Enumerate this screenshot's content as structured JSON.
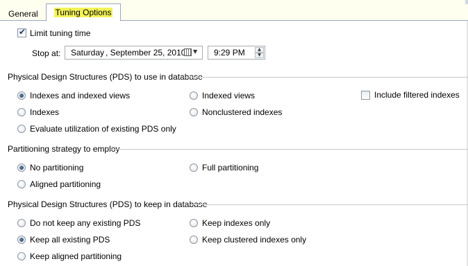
{
  "tabs": {
    "general": "General",
    "tuning": "Tuning Options"
  },
  "limit": {
    "label": "Limit tuning time",
    "checked": true,
    "stop_label": "Stop at:",
    "day": "Saturday",
    "date": ", September 25, 2010",
    "time": "9:29 PM"
  },
  "pds_use": {
    "title": "Physical Design Structures (PDS) to use in database",
    "options": [
      "Indexes and indexed views",
      "Indexed views",
      "Indexes",
      "Nonclustered indexes",
      "Evaluate utilization of existing PDS only"
    ],
    "selected": "Indexes and indexed views",
    "filtered_label": "Include filtered indexes",
    "filtered_checked": false
  },
  "partitioning": {
    "title": "Partitioning strategy to employ",
    "options": [
      "No partitioning",
      "Full partitioning",
      "Aligned partitioning"
    ],
    "selected": "No partitioning"
  },
  "pds_keep": {
    "title": "Physical Design Structures (PDS) to keep in database",
    "options": [
      "Do not keep any existing PDS",
      "Keep indexes only",
      "Keep all existing PDS",
      "Keep clustered indexes only",
      "Keep aligned partitioning"
    ],
    "selected": "Keep all existing PDS"
  }
}
